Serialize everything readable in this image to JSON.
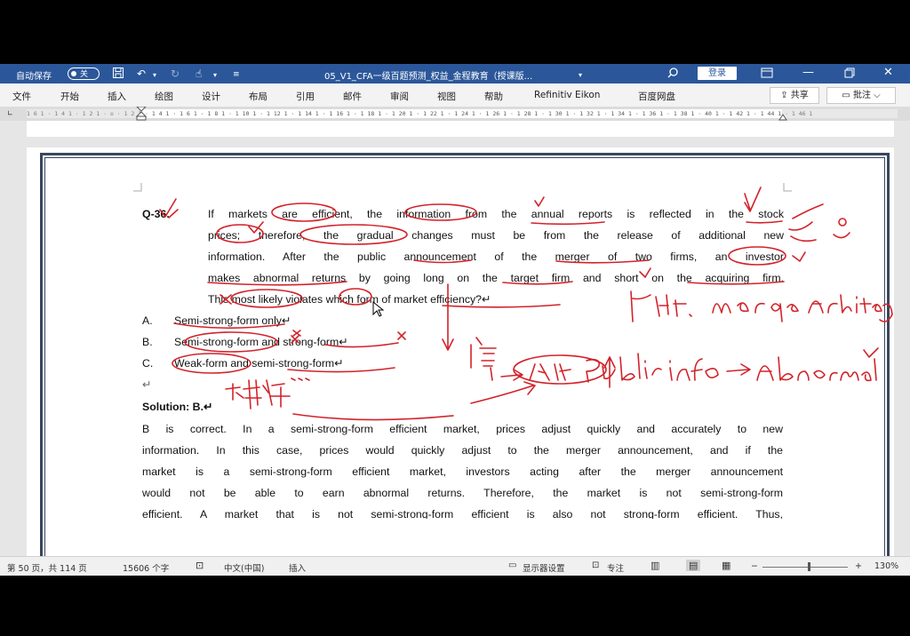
{
  "titlebar": {
    "autosave_label": "自动保存",
    "autosave_state": "关",
    "document_title": "05_V1_CFA一级百题预测_权益_金程教育（授课版...",
    "login_label": "登录"
  },
  "menu": {
    "items": [
      "文件",
      "开始",
      "插入",
      "绘图",
      "设计",
      "布局",
      "引用",
      "邮件",
      "审阅",
      "视图",
      "帮助",
      "Refinitiv Eikon",
      "百度网盘"
    ],
    "share_label": "共享",
    "comment_label": "批注"
  },
  "ruler": {
    "ticks": "1 6 1 · 1 4 1 · 1 2 1 · ☒ · 1 2 1 · 1 4 1 · 1 6 1 · 1 8 1 · 1 10 1 · 1 12 1 · 1 14 1 · 1 16 1 · 1 18 1 · 1 20 1 · 1 22 1 · 1 24 1 · 1 26 1 · 1 28 1 · 1 30 1 · 1 32 1 · 1 34 1 · 1 36 1 · 1 38 1 · 40 1 · 1 42 1 · 1 44 1 · 1 46 1"
  },
  "document": {
    "question_number": "Q-36.",
    "question_lines": [
      "If markets are efficient, the information from the annual reports is reflected in the stock",
      "prices; therefore, the gradual changes must be from the release of additional new",
      "information. After the public announcement of the merger of two firms, an investor",
      "makes abnormal returns by going long on the target firm and short on the acquiring firm.",
      "This most likely violates which form of market efficiency?↵"
    ],
    "options": [
      {
        "letter": "A.",
        "text": "Semi-strong-form only↵"
      },
      {
        "letter": "B.",
        "text": "Semi-strong-form and strong-form↵"
      },
      {
        "letter": "C.",
        "text": "Weak-form and semi-strong-form↵"
      }
    ],
    "empty_paragraph": "↵",
    "solution_heading": "Solution: B.↵",
    "solution_lines": [
      "B is correct. In a semi-strong-form efficient market, prices adjust quickly and accurately to new",
      "information. In this case, prices would quickly adjust to the merger announcement, and if the",
      "market is a semi-strong-form efficient market, investors acting after the merger announcement",
      "would not be able to earn abnormal returns. Therefore, the market is not semi-strong-form",
      "efficient. A market that is not semi-strong-form efficient is also not strong-form efficient. Thus,"
    ],
    "ink_color": "#d2232a"
  },
  "statusbar": {
    "page_info": "第 50 页，共 114 页",
    "word_count": "15606 个字",
    "language": "中文(中国)",
    "insert_mode": "插入",
    "display_settings": "显示器设置",
    "focus": "专注",
    "zoom_minus": "−",
    "zoom_plus": "+",
    "zoom": "130%"
  }
}
